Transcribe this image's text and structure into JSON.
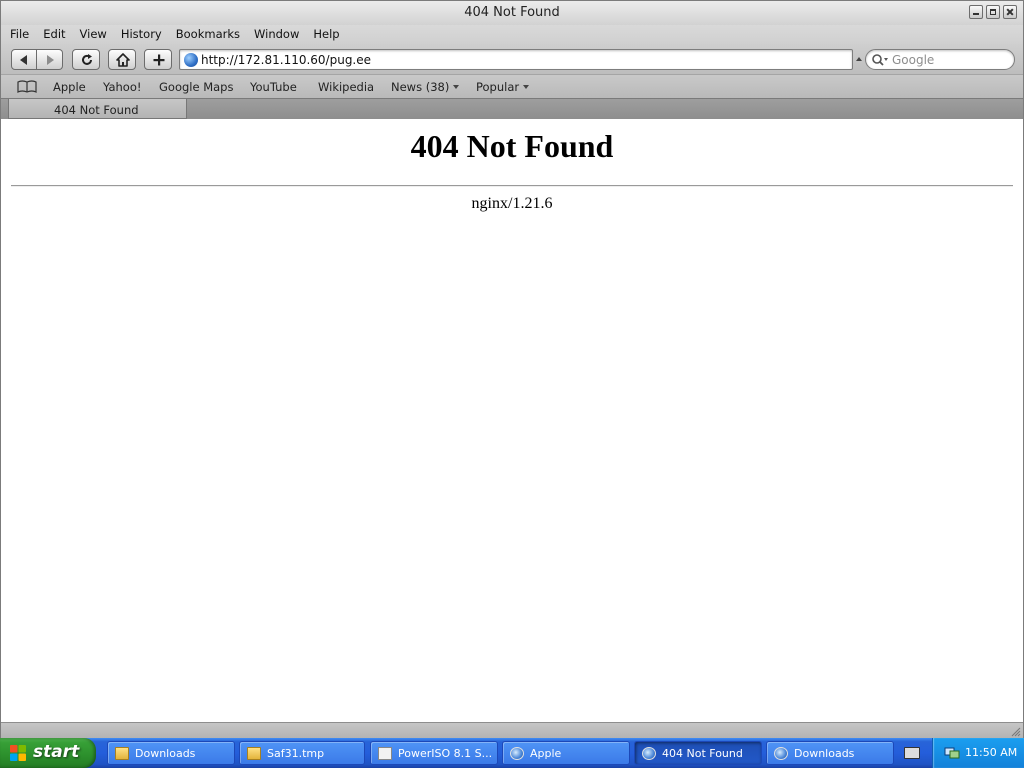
{
  "window": {
    "title": "404 Not Found"
  },
  "menubar": {
    "items": [
      "File",
      "Edit",
      "View",
      "History",
      "Bookmarks",
      "Window",
      "Help"
    ]
  },
  "toolbar": {
    "back_icon": "back-arrow-icon",
    "forward_icon": "forward-arrow-icon",
    "reload_icon": "reload-icon",
    "home_icon": "home-icon",
    "add_icon": "add-bookmark-icon",
    "url": "http://172.81.110.60/pug.ee",
    "search_placeholder": "Google"
  },
  "bookmarks": {
    "items": [
      "Apple",
      "Yahoo!",
      "Google Maps",
      "YouTube",
      "Wikipedia",
      "News (38)",
      "Popular"
    ]
  },
  "tabs": {
    "active_label": "404 Not Found"
  },
  "page": {
    "heading": "404 Not Found",
    "server": "nginx/1.21.6"
  },
  "taskbar": {
    "start_label": "start",
    "tasks": [
      {
        "label": "Downloads",
        "icon": "folder-icon",
        "active": false
      },
      {
        "label": "Saf31.tmp",
        "icon": "folder-icon",
        "active": false
      },
      {
        "label": "PowerISO 8.1 S...",
        "icon": "installer-icon",
        "active": false
      },
      {
        "label": "Apple",
        "icon": "safari-icon",
        "active": false
      },
      {
        "label": "404 Not Found",
        "icon": "safari-icon",
        "active": true
      },
      {
        "label": "Downloads",
        "icon": "safari-icon",
        "active": false
      }
    ],
    "clock": "11:50 AM"
  },
  "colors": {
    "taskbar_blue": "#245edb",
    "start_green": "#37a037",
    "tray_blue": "#1b9ff0"
  }
}
